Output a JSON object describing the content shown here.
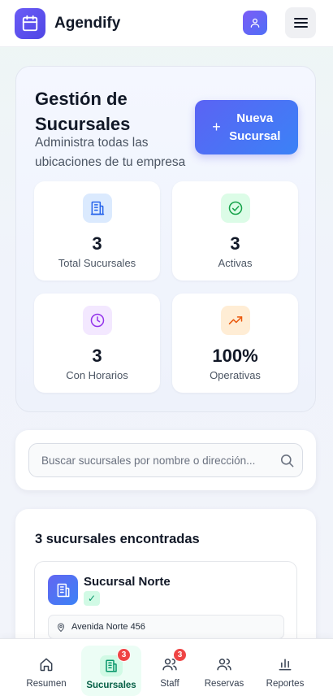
{
  "header": {
    "brand": "Agendify",
    "logo_icon": "calendar-icon",
    "user_icon": "user-icon",
    "menu_icon": "hamburger-menu-icon"
  },
  "hero": {
    "title": "Gestión de Sucursales",
    "subtitle": "Administra todas las ubicaciones de tu empresa",
    "new_button_label": "Nueva Sucursal",
    "new_button_icon": "plus"
  },
  "stats": [
    {
      "value": "3",
      "label": "Total Sucursales",
      "icon": "building-icon",
      "color": "#2563eb",
      "bg": "#dbeafe"
    },
    {
      "value": "3",
      "label": "Activas",
      "icon": "check-circle-icon",
      "color": "#16a34a",
      "bg": "#dcfce7"
    },
    {
      "value": "3",
      "label": "Con Horarios",
      "icon": "clock-icon",
      "color": "#9333ea",
      "bg": "#f3e8ff"
    },
    {
      "value": "100%",
      "label": "Operativas",
      "icon": "trending-up-icon",
      "color": "#ea580c",
      "bg": "#ffedd5"
    }
  ],
  "search": {
    "placeholder": "Buscar sucursales por nombre o dirección...",
    "value": ""
  },
  "results": {
    "title": "3 sucursales encontradas",
    "branches": [
      {
        "name": "Sucursal Norte",
        "status": "✓",
        "address": "Avenida Norte 456"
      }
    ]
  },
  "bottom_nav": [
    {
      "label": "Resumen",
      "icon": "home-icon",
      "badge": "",
      "active": false
    },
    {
      "label": "Sucursales",
      "icon": "building-icon",
      "badge": "3",
      "active": true
    },
    {
      "label": "Staff",
      "icon": "users-icon",
      "badge": "3",
      "active": false
    },
    {
      "label": "Reservas",
      "icon": "users-icon",
      "badge": "",
      "active": false
    },
    {
      "label": "Reportes",
      "icon": "bar-chart-icon",
      "badge": "",
      "active": false
    }
  ],
  "colors": {
    "brand": "#4f46e5",
    "accent_green": "#059669",
    "badge_red": "#ef4444"
  }
}
